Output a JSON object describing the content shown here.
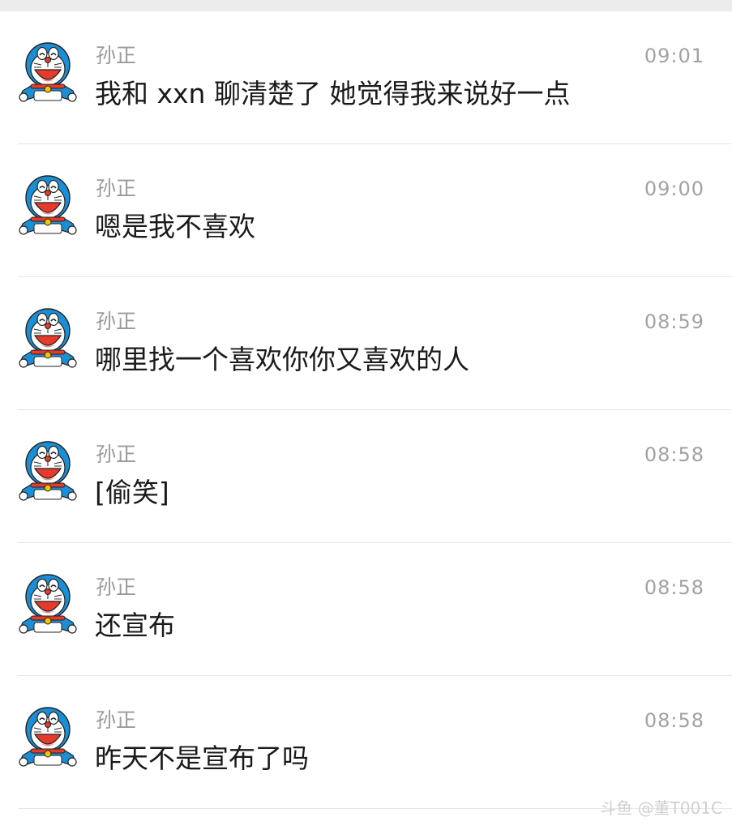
{
  "messages": [
    {
      "sender": "孙正",
      "time": "09:01",
      "text": "我和 xxn 聊清楚了 她觉得我来说好一点"
    },
    {
      "sender": "孙正",
      "time": "09:00",
      "text": "嗯是我不喜欢"
    },
    {
      "sender": "孙正",
      "time": "08:59",
      "text": "哪里找一个喜欢你你又喜欢的人"
    },
    {
      "sender": "孙正",
      "time": "08:58",
      "text": "[偷笑]"
    },
    {
      "sender": "孙正",
      "time": "08:58",
      "text": "还宣布"
    },
    {
      "sender": "孙正",
      "time": "08:58",
      "text": "昨天不是宣布了吗"
    }
  ],
  "avatar_icon": "doraemon-avatar",
  "watermark": "斗鱼 @董T001C",
  "colors": {
    "background": "#ffffff",
    "divider": "#e6e6e6",
    "name": "#9a9a9a",
    "time": "#a2a2a2",
    "message": "#1a1a1a",
    "avatar_blue": "#1a8fd6",
    "avatar_red": "#e63a2a"
  }
}
